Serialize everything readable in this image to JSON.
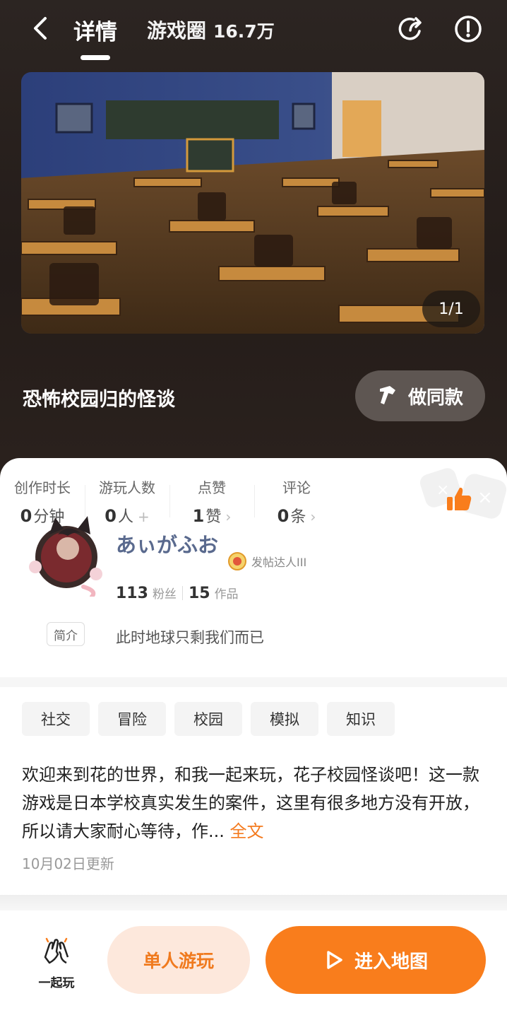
{
  "nav": {
    "detail_tab": "详情",
    "circle_tab": "游戏圈",
    "circle_count": "16.7万"
  },
  "media": {
    "page_indicator": "1/1"
  },
  "game": {
    "title": "恐怖校园归的怪谈",
    "make_same_label": "做同款"
  },
  "stats": [
    {
      "label": "创作时长",
      "value": "0",
      "unit": "分钟",
      "suffix": ""
    },
    {
      "label": "游玩人数",
      "value": "0",
      "unit": "人",
      "suffix": "+"
    },
    {
      "label": "点赞",
      "value": "1",
      "unit": "赞",
      "suffix": "›"
    },
    {
      "label": "评论",
      "value": "0",
      "unit": "条",
      "suffix": "›"
    }
  ],
  "author": {
    "name": "あぃがふお",
    "level": "发帖达人III",
    "followers_count": "113",
    "followers_label": "粉丝",
    "works_count": "15",
    "works_label": "作品",
    "intro_label": "简介",
    "bio": "此时地球只剩我们而已"
  },
  "tags": [
    "社交",
    "冒险",
    "校园",
    "模拟",
    "知识"
  ],
  "description": {
    "text": "欢迎来到花的世界，和我一起来玩，花子校园怪谈吧！这一款游戏是日本学校真实发生的案件，这里有很多地方没有开放，所以请大家耐心等待，作...",
    "more": "全文"
  },
  "updated": "10月02日更新",
  "bottom": {
    "together_label": "一起玩",
    "solo_label": "单人游玩",
    "enter_label": "进入地图"
  },
  "colors": {
    "accent": "#f97d1c",
    "accent_light": "#fde8dc",
    "username": "#5a6a8e",
    "hero_bg": "#2a211d"
  }
}
